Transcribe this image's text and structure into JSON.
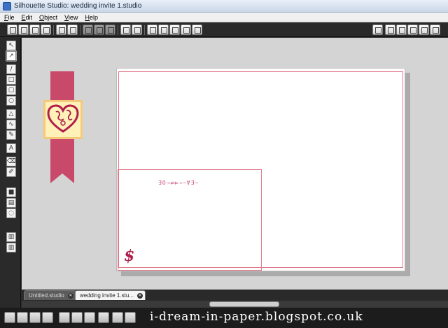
{
  "window": {
    "title": "Silhouette Studio: wedding invite 1.studio"
  },
  "menu": [
    {
      "first": "F",
      "rest": "ile"
    },
    {
      "first": "E",
      "rest": "dit"
    },
    {
      "first": "O",
      "rest": "bject"
    },
    {
      "first": "V",
      "rest": "iew"
    },
    {
      "first": "H",
      "rest": "elp"
    }
  ],
  "canvas": {
    "design_text": "ƎO⇢⇄⇇⇢–ⱯƎ–",
    "monogram": "$"
  },
  "tabs": [
    {
      "label": "Untitled.studio",
      "close": "✕"
    },
    {
      "label": "wedding invite 1.stu...",
      "close": "✕"
    }
  ],
  "watermark": "i-dream-in-paper.blogspot.co.uk",
  "colors": {
    "accent_pink": "#c9496a",
    "cut_line": "#e07a8a",
    "heart_red": "#b01d49",
    "panel_dark": "#2a2a2a",
    "workspace": "#d4d4d4"
  },
  "icons": {
    "new": "new-doc-icon",
    "open": "open-folder-icon",
    "save": "save-icon",
    "print": "print-icon",
    "undo": "undo-icon",
    "redo": "redo-icon",
    "zoom_in": "zoom-in-icon",
    "zoom_out": "zoom-out-icon"
  }
}
